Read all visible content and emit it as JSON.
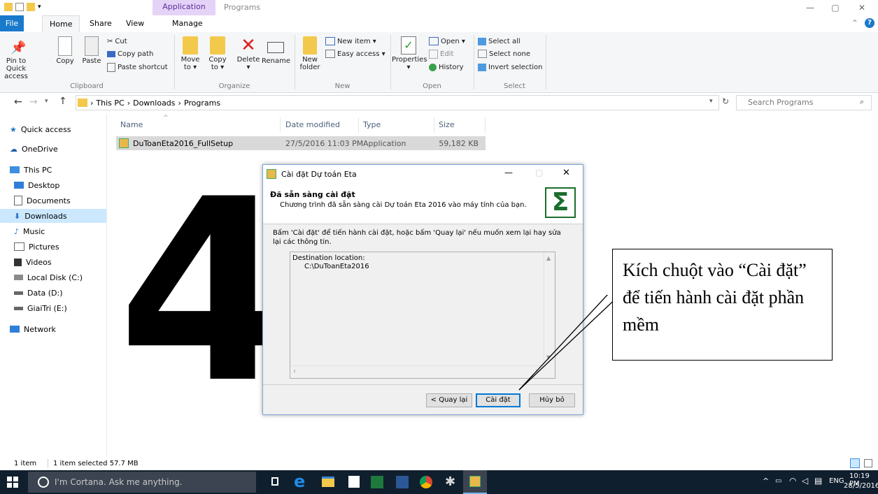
{
  "titlebar": {
    "context_tab": "Application Tools",
    "title": "Programs"
  },
  "tabs": [
    "File",
    "Home",
    "Share",
    "View",
    "Manage"
  ],
  "ribbon": {
    "clipboard": {
      "pin": "Pin to Quick access",
      "copy": "Copy",
      "paste": "Paste",
      "cut": "Cut",
      "copy_path": "Copy path",
      "paste_shortcut": "Paste shortcut",
      "label": "Clipboard"
    },
    "organize": {
      "move": "Move to ▾",
      "copy": "Copy to ▾",
      "delete": "Delete ▾",
      "rename": "Rename",
      "label": "Organize"
    },
    "new": {
      "new_folder": "New folder",
      "new_item": "New item ▾",
      "easy_access": "Easy access ▾",
      "label": "New"
    },
    "open": {
      "properties": "Properties ▾",
      "open": "Open ▾",
      "edit": "Edit",
      "history": "History",
      "label": "Open"
    },
    "select": {
      "all": "Select all",
      "none": "Select none",
      "invert": "Invert selection",
      "label": "Select"
    }
  },
  "address": {
    "crumbs": [
      "This PC",
      "Downloads",
      "Programs"
    ],
    "search_placeholder": "Search Programs"
  },
  "nav": [
    "Quick access",
    "OneDrive",
    "This PC",
    "Desktop",
    "Documents",
    "Downloads",
    "Music",
    "Pictures",
    "Videos",
    "Local Disk (C:)",
    "Data (D:)",
    "GiaiTri (E:)",
    "Network"
  ],
  "columns": {
    "name": "Name",
    "date": "Date modified",
    "type": "Type",
    "size": "Size"
  },
  "file": {
    "name": "DuToanEta2016_FullSetup",
    "date": "27/5/2016 11:03 PM",
    "type": "Application",
    "size": "59,182 KB"
  },
  "big_number": "4",
  "dialog": {
    "title": "Cài đặt Dự toán Eta",
    "heading": "Đã sẵn sàng cài đặt",
    "subheading": "Chương trình đã sẵn sàng cài Dự toán Eta 2016 vào máy tính của bạn.",
    "instruction": "Bấm 'Cài đặt' để tiến hành cài đặt, hoặc bấm 'Quay lại' nếu muốn xem lại hay sửa lại các thông tin.",
    "dest_label": "Destination location:",
    "dest_path": "C:\\DuToanEta2016",
    "back": "< Quay lại",
    "install": "Cài đặt",
    "cancel": "Hủy bỏ"
  },
  "callout": "Kích chuột vào “Cài đặt” để tiến hành cài đặt phần mềm",
  "status": {
    "items": "1 item",
    "selected": "1 item selected  57.7 MB"
  },
  "taskbar": {
    "cortana": "I'm Cortana. Ask me anything.",
    "lang": "ENG",
    "time": "10:19 PM",
    "date": "28/5/2016"
  },
  "colors": {
    "accent": "#1979ca",
    "taskbar": "#101f2e",
    "selected": "#cce8ff"
  }
}
